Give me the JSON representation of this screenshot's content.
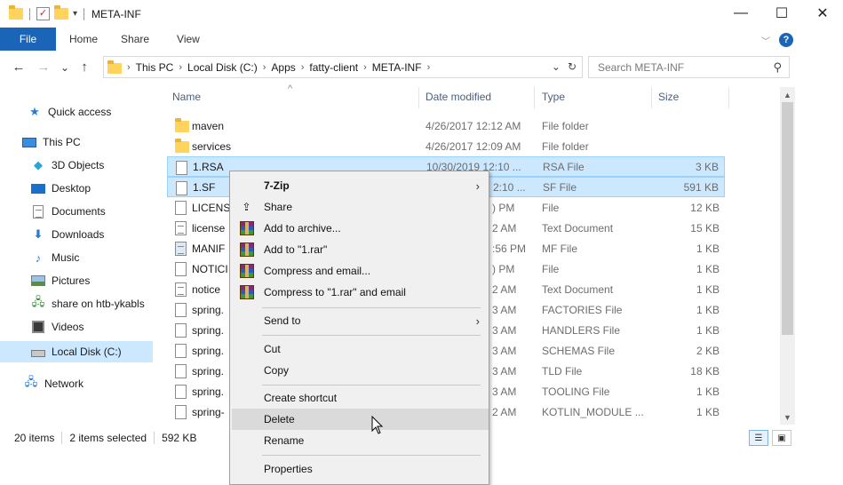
{
  "window": {
    "title": "META-INF",
    "minimize": "—",
    "maximize": "☐",
    "close": "✕"
  },
  "ribbon": {
    "file": "File",
    "tabs": [
      "Home",
      "Share",
      "View"
    ],
    "expand": "﹀",
    "help": "?"
  },
  "nav": {
    "back": "←",
    "forward": "→",
    "recent": "⌄",
    "up": "↑",
    "breadcrumbs": [
      "This PC",
      "Local Disk (C:)",
      "Apps",
      "fatty-client",
      "META-INF"
    ],
    "search_placeholder": "Search META-INF"
  },
  "navpane": {
    "items": [
      {
        "label": "Quick access",
        "icon": "star-icon"
      },
      {
        "label": "This PC",
        "icon": "computer-icon"
      },
      {
        "label": "3D Objects",
        "icon": "cube-icon"
      },
      {
        "label": "Desktop",
        "icon": "desktop-icon"
      },
      {
        "label": "Documents",
        "icon": "documents-icon"
      },
      {
        "label": "Downloads",
        "icon": "download-icon"
      },
      {
        "label": "Music",
        "icon": "music-icon"
      },
      {
        "label": "Pictures",
        "icon": "pictures-icon"
      },
      {
        "label": "share on htb-ykabls",
        "icon": "network-drive-icon"
      },
      {
        "label": "Videos",
        "icon": "videos-icon"
      },
      {
        "label": "Local Disk (C:)",
        "icon": "drive-icon"
      },
      {
        "label": "Network",
        "icon": "network-icon"
      }
    ]
  },
  "columns": {
    "name": "Name",
    "date": "Date modified",
    "type": "Type",
    "size": "Size"
  },
  "files": [
    {
      "name": "maven",
      "date": "4/26/2017 12:12 AM",
      "type": "File folder",
      "size": "",
      "kind": "folder"
    },
    {
      "name": "services",
      "date": "4/26/2017 12:09 AM",
      "type": "File folder",
      "size": "",
      "kind": "folder"
    },
    {
      "name": "1.RSA",
      "date": "10/30/2019 12:10 ...",
      "type": "RSA File",
      "size": "3 KB",
      "kind": "file"
    },
    {
      "name": "1.SF",
      "date": "2:10 ...",
      "type": "SF File",
      "size": "591 KB",
      "kind": "file"
    },
    {
      "name": "LICENS",
      "date": ") PM",
      "type": "File",
      "size": "12 KB",
      "kind": "file"
    },
    {
      "name": "license",
      "date": "2 AM",
      "type": "Text Document",
      "size": "15 KB",
      "kind": "text"
    },
    {
      "name": "MANIF",
      "date": ":56 PM",
      "type": "MF File",
      "size": "1 KB",
      "kind": "mf"
    },
    {
      "name": "NOTICI",
      "date": ") PM",
      "type": "File",
      "size": "1 KB",
      "kind": "file"
    },
    {
      "name": "notice",
      "date": "2 AM",
      "type": "Text Document",
      "size": "1 KB",
      "kind": "text"
    },
    {
      "name": "spring.",
      "date": "3 AM",
      "type": "FACTORIES File",
      "size": "1 KB",
      "kind": "file"
    },
    {
      "name": "spring.",
      "date": "3 AM",
      "type": "HANDLERS File",
      "size": "1 KB",
      "kind": "file"
    },
    {
      "name": "spring.",
      "date": "3 AM",
      "type": "SCHEMAS File",
      "size": "2 KB",
      "kind": "file"
    },
    {
      "name": "spring.",
      "date": "3 AM",
      "type": "TLD File",
      "size": "18 KB",
      "kind": "file"
    },
    {
      "name": "spring.",
      "date": "3 AM",
      "type": "TOOLING File",
      "size": "1 KB",
      "kind": "file"
    },
    {
      "name": "spring-",
      "date": "2 AM",
      "type": "KOTLIN_MODULE ...",
      "size": "1 KB",
      "kind": "file"
    }
  ],
  "status": {
    "count": "20 items",
    "selected": "2 items selected",
    "size": "592 KB"
  },
  "context_menu": {
    "items": [
      {
        "label": "7-Zip",
        "bold": true,
        "submenu": true,
        "icon": ""
      },
      {
        "label": "Share",
        "icon": "share-icon"
      },
      {
        "label": "Add to archive...",
        "icon": "winrar-icon"
      },
      {
        "label": "Add to \"1.rar\"",
        "icon": "winrar-icon"
      },
      {
        "label": "Compress and email...",
        "icon": "winrar-icon"
      },
      {
        "label": "Compress to \"1.rar\" and email",
        "icon": "winrar-icon"
      },
      {
        "label": "Send to",
        "submenu": true
      },
      {
        "label": "Cut"
      },
      {
        "label": "Copy"
      },
      {
        "label": "Create shortcut"
      },
      {
        "label": "Delete",
        "highlighted": true
      },
      {
        "label": "Rename"
      },
      {
        "label": "Properties"
      }
    ],
    "submenu_arrow": "›"
  }
}
